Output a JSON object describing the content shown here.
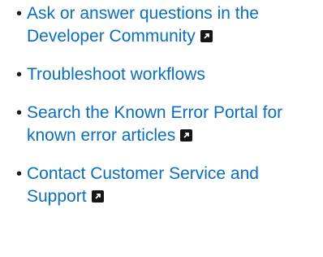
{
  "links": [
    {
      "text": "Ask or answer questions in the Developer Community",
      "external": true,
      "icon": "external-link-icon"
    },
    {
      "text": "Troubleshoot workflows",
      "external": false
    },
    {
      "text": "Search the Known Error Portal for known error articles",
      "external": true,
      "icon": "external-link-icon"
    },
    {
      "text": "Contact Customer Service and Support",
      "external": true,
      "icon": "external-link-icon"
    }
  ],
  "colors": {
    "link": "#0a6ebd",
    "bullet": "#1a1a1a",
    "icon_bg": "#161616"
  }
}
